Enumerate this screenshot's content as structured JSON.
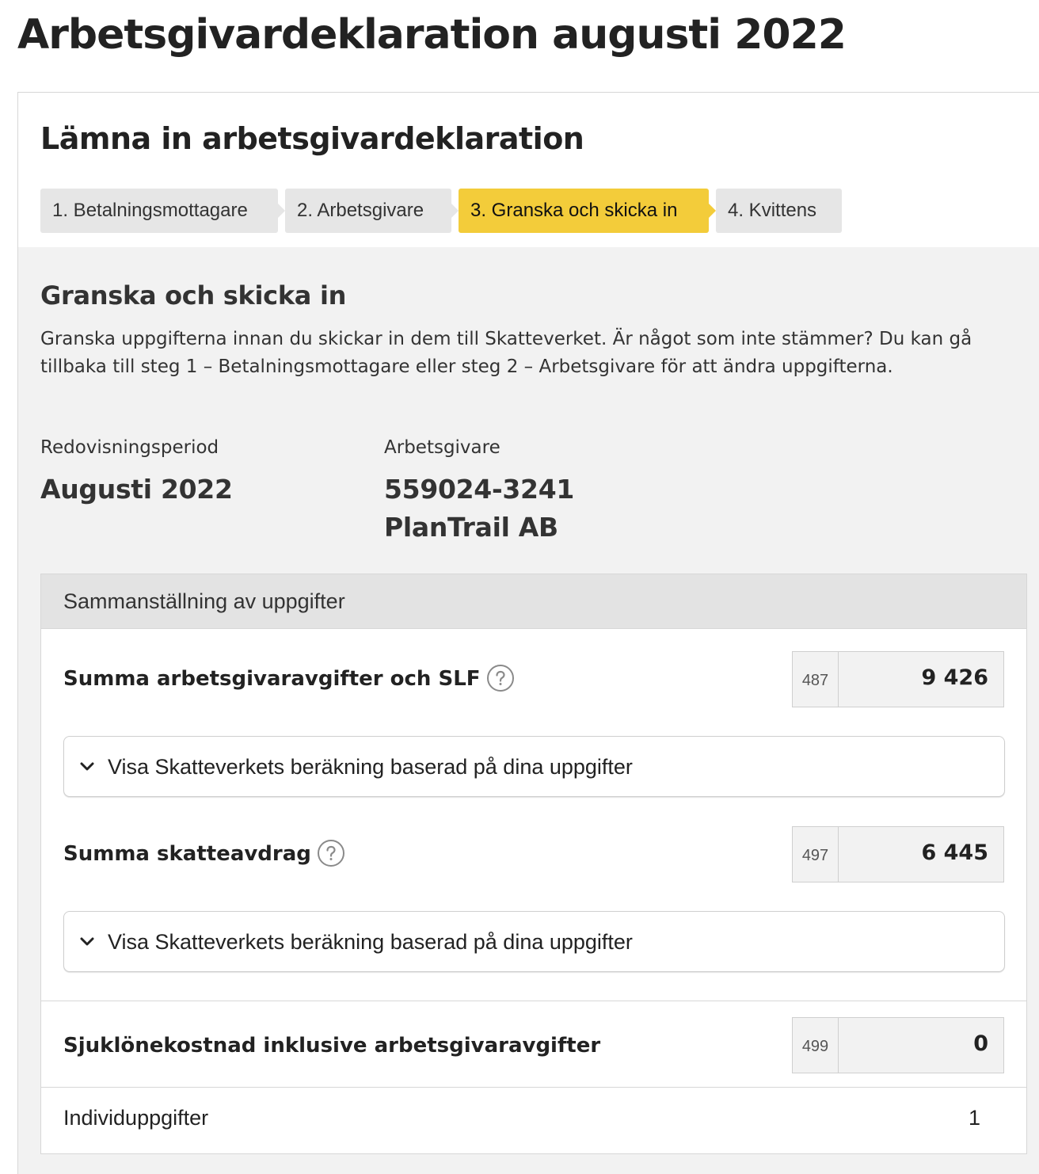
{
  "page": {
    "title": "Arbetsgivardeklaration augusti 2022"
  },
  "form": {
    "title": "Lämna in arbetsgivardeklaration",
    "steps": [
      {
        "label": "1. Betalningsmottagare",
        "active": false
      },
      {
        "label": "2. Arbetsgivare",
        "active": false
      },
      {
        "label": "3. Granska och skicka in",
        "active": true
      },
      {
        "label": "4. Kvittens",
        "active": false
      }
    ]
  },
  "review": {
    "title": "Granska och skicka in",
    "description": "Granska uppgifterna innan du skickar in dem till Skatteverket. Är något som inte stämmer? Du kan gå tillbaka till steg 1 – Betalningsmottagare eller steg 2 – Arbetsgivare för att ändra uppgifterna.",
    "period_label": "Redovisningsperiod",
    "period_value": "Augusti 2022",
    "employer_label": "Arbetsgivare",
    "employer_org_number": "559024-3241",
    "employer_name": "PlanTrail AB"
  },
  "summary": {
    "heading": "Sammanställning av uppgifter",
    "rows": [
      {
        "label": "Summa arbetsgivaravgifter och SLF",
        "code": "487",
        "value": "9 426",
        "help_icon": "question-circle-icon",
        "expander_label": "Visa Skatteverkets beräkning baserad på dina uppgifter"
      },
      {
        "label": "Summa skatteavdrag",
        "code": "497",
        "value": "6 445",
        "help_icon": "question-circle-icon",
        "expander_label": "Visa Skatteverkets beräkning baserad på dina uppgifter"
      },
      {
        "label": "Sjuklönekostnad inklusive arbetsgivaravgifter",
        "code": "499",
        "value": "0"
      }
    ],
    "individual_label": "Individuppgifter",
    "individual_count": "1"
  },
  "colors": {
    "active_step": "#f3cc3a",
    "inactive_step": "#e6e6e6",
    "panel_background": "#f2f2f2",
    "summary_header": "#e3e3e3",
    "text": "#222222"
  }
}
